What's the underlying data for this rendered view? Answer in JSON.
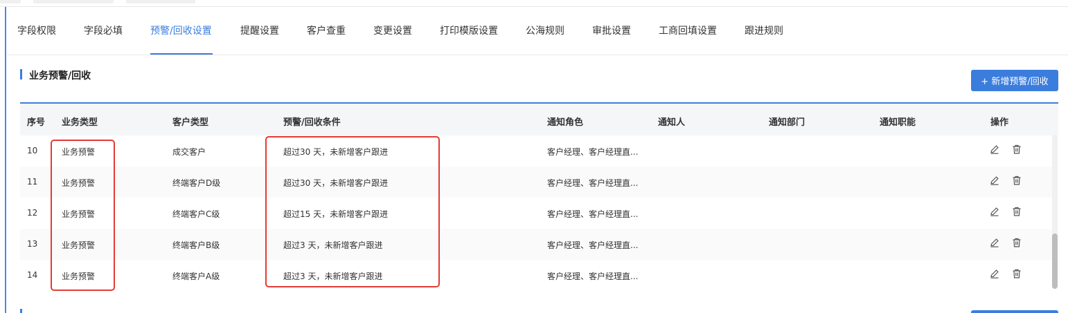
{
  "tabs": [
    {
      "label": "字段权限"
    },
    {
      "label": "字段必填"
    },
    {
      "label": "预警/回收设置",
      "active": true
    },
    {
      "label": "提醒设置"
    },
    {
      "label": "客户查重"
    },
    {
      "label": "变更设置"
    },
    {
      "label": "打印模版设置"
    },
    {
      "label": "公海规则"
    },
    {
      "label": "审批设置"
    },
    {
      "label": "工商回填设置"
    },
    {
      "label": "跟进规则"
    }
  ],
  "section": {
    "title": "业务预警/回收",
    "add_button": "+ 新增预警/回收"
  },
  "table": {
    "headers": [
      "序号",
      "业务类型",
      "客户类型",
      "预警/回收条件",
      "通知角色",
      "通知人",
      "通知部门",
      "通知职能",
      "操作"
    ],
    "rows": [
      {
        "no": "10",
        "biz_type": "业务预警",
        "customer_type": "成交客户",
        "condition": "超过30 天，未新增客户跟进",
        "roles": "客户经理、客户经理直...",
        "person": "",
        "dept": "",
        "func": ""
      },
      {
        "no": "11",
        "biz_type": "业务预警",
        "customer_type": "终端客户D级",
        "condition": "超过30 天，未新增客户跟进",
        "roles": "客户经理、客户经理直...",
        "person": "",
        "dept": "",
        "func": ""
      },
      {
        "no": "12",
        "biz_type": "业务预警",
        "customer_type": "终端客户C级",
        "condition": "超过15 天，未新增客户跟进",
        "roles": "客户经理、客户经理直...",
        "person": "",
        "dept": "",
        "func": ""
      },
      {
        "no": "13",
        "biz_type": "业务预警",
        "customer_type": "终端客户B级",
        "condition": "超过3 天，未新增客户跟进",
        "roles": "客户经理、客户经理直...",
        "person": "",
        "dept": "",
        "func": ""
      },
      {
        "no": "14",
        "biz_type": "业务预警",
        "customer_type": "终端客户A级",
        "condition": "超过3 天，未新增客户跟进",
        "roles": "客户经理、客户经理直...",
        "person": "",
        "dept": "",
        "func": ""
      }
    ]
  },
  "icons": {
    "edit": "edit-icon",
    "delete": "trash-icon"
  },
  "colors": {
    "accent": "#3b7ddd",
    "highlight": "#e53935"
  }
}
